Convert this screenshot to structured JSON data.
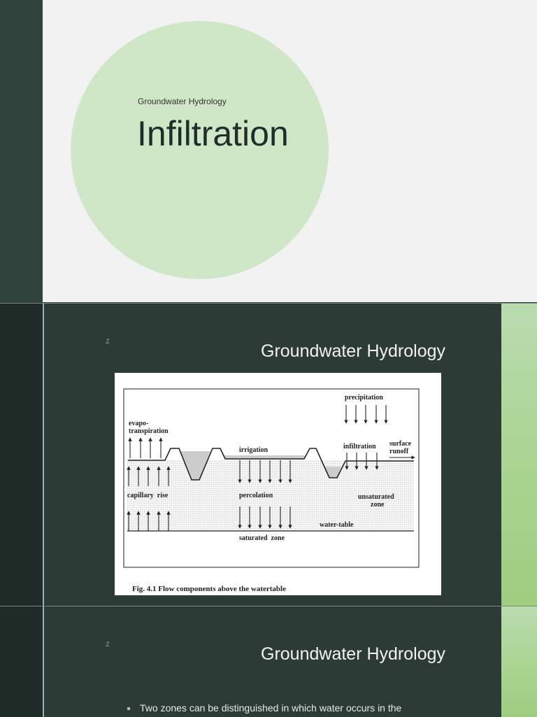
{
  "slide1": {
    "subtitle": "Groundwater Hydrology",
    "title": "Infiltration"
  },
  "slide2": {
    "marker": "z",
    "heading": "Groundwater Hydrology",
    "figure": {
      "labels": {
        "precipitation": "precipitation",
        "evapo": "evapo-",
        "transpiration": "transpiration",
        "irrigation": "irrigation",
        "infiltration": "infiltration",
        "surface": "surface",
        "runoff": "runoff",
        "capillary_rise": "capillary  rise",
        "percolation": "percolation",
        "unsaturated": "unsaturated",
        "zone": "zone",
        "water_table": "water-table",
        "saturated_zone": "saturated  zone"
      },
      "caption": "Fig. 4.1  Flow components above the watertable"
    }
  },
  "slide3": {
    "marker": "z",
    "heading": "Groundwater Hydrology",
    "bullet": "Two zones can be distinguished in which water occurs in the"
  }
}
